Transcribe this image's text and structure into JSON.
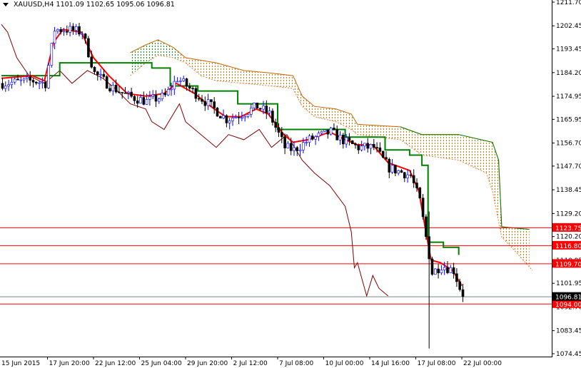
{
  "header": {
    "symbol": "XAUUSD,H4",
    "open": "1101.09",
    "high": "1102.65",
    "low": "1095.06",
    "close": "1096.81"
  },
  "colors": {
    "bull": "#0000ff",
    "bear": "#000000",
    "tenkan": "#ff0000",
    "kijun": "#008000",
    "chikou": "#800000",
    "cloud_bear": "#ff6600",
    "cloud_bull": "#00a000",
    "level": "#ff0000",
    "bid": "#778899"
  },
  "chart_data": {
    "type": "candlestick",
    "price_axis": {
      "range": [
        1074.45,
        1211.7
      ],
      "ticks": [
        "1211.70",
        "1202.45",
        "1193.45",
        "1184.20",
        "1174.95",
        "1165.95",
        "1156.70",
        "1147.70",
        "1138.45",
        "1129.20",
        "1120.20",
        "1110.95",
        "1101.95",
        "1092.70",
        "1083.45",
        "1074.45"
      ]
    },
    "time_axis": {
      "labels": [
        "15 Jun 2015",
        "17 Jun 20:00",
        "22 Jun 12:00",
        "25 Jun 04:00",
        "29 Jun 20:00",
        "2 Jul 12:00",
        "7 Jul 08:00",
        "10 Jul 00:00",
        "14 Jul 16:00",
        "17 Jul 08:00",
        "22 Jul 00:00"
      ],
      "bars_per_label": 15
    },
    "bars_visible": 180,
    "close_path": [
      [
        0,
        1180
      ],
      [
        10,
        1181
      ],
      [
        14,
        1180
      ],
      [
        17,
        1201
      ],
      [
        21,
        1201
      ],
      [
        26,
        1200
      ],
      [
        30,
        1184
      ],
      [
        35,
        1179
      ],
      [
        41,
        1175
      ],
      [
        47,
        1173
      ],
      [
        53,
        1175
      ],
      [
        57,
        1182
      ],
      [
        63,
        1176
      ],
      [
        67,
        1172
      ],
      [
        73,
        1166
      ],
      [
        78,
        1168
      ],
      [
        83,
        1171
      ],
      [
        87,
        1168
      ],
      [
        92,
        1155
      ],
      [
        95,
        1154
      ],
      [
        100,
        1158
      ],
      [
        107,
        1161
      ],
      [
        112,
        1157
      ],
      [
        116,
        1155
      ],
      [
        121,
        1155
      ],
      [
        126,
        1147
      ],
      [
        133,
        1144
      ],
      [
        136,
        1134
      ],
      [
        138,
        1120
      ],
      [
        140,
        1106
      ],
      [
        143,
        1109
      ],
      [
        147,
        1107
      ],
      [
        150,
        1096.81
      ]
    ],
    "spike": {
      "bar": 139,
      "low": 1076.5,
      "high": 1130
    },
    "tenkan": [
      [
        0,
        1182
      ],
      [
        10,
        1183
      ],
      [
        14,
        1181
      ],
      [
        17,
        1196
      ],
      [
        20,
        1201
      ],
      [
        26,
        1200
      ],
      [
        30,
        1190
      ],
      [
        35,
        1183
      ],
      [
        41,
        1176
      ],
      [
        47,
        1175
      ],
      [
        53,
        1176
      ],
      [
        57,
        1180
      ],
      [
        63,
        1176
      ],
      [
        67,
        1172
      ],
      [
        73,
        1167
      ],
      [
        78,
        1167
      ],
      [
        83,
        1170
      ],
      [
        87,
        1168
      ],
      [
        92,
        1160
      ],
      [
        95,
        1157
      ],
      [
        100,
        1158
      ],
      [
        107,
        1161
      ],
      [
        112,
        1158
      ],
      [
        116,
        1156
      ],
      [
        121,
        1156
      ],
      [
        126,
        1149
      ],
      [
        133,
        1146
      ],
      [
        136,
        1138
      ],
      [
        138,
        1124
      ],
      [
        140,
        1111
      ],
      [
        143,
        1110
      ],
      [
        147,
        1107
      ],
      [
        150,
        1101
      ]
    ],
    "kijun": [
      [
        0,
        1183
      ],
      [
        17,
        1183
      ],
      [
        19,
        1188
      ],
      [
        42,
        1188
      ],
      [
        49,
        1186
      ],
      [
        55,
        1179
      ],
      [
        64,
        1177
      ],
      [
        75,
        1177
      ],
      [
        77,
        1172
      ],
      [
        89,
        1172
      ],
      [
        90,
        1162
      ],
      [
        109,
        1162
      ],
      [
        112,
        1159
      ],
      [
        125,
        1154
      ],
      [
        133,
        1152
      ],
      [
        137,
        1148
      ],
      [
        139,
        1118
      ],
      [
        144,
        1116
      ],
      [
        149,
        1113
      ]
    ],
    "chikou": [
      [
        0,
        1203
      ],
      [
        2,
        1200
      ],
      [
        5,
        1190
      ],
      [
        9,
        1183
      ],
      [
        14,
        1180
      ],
      [
        19,
        1185
      ],
      [
        23,
        1180
      ],
      [
        28,
        1185
      ],
      [
        33,
        1182
      ],
      [
        37,
        1178
      ],
      [
        42,
        1172
      ],
      [
        47,
        1170
      ],
      [
        49,
        1165
      ],
      [
        53,
        1162
      ],
      [
        58,
        1172
      ],
      [
        60,
        1165
      ],
      [
        65,
        1160
      ],
      [
        70,
        1155
      ],
      [
        74,
        1160
      ],
      [
        79,
        1158
      ],
      [
        84,
        1162
      ],
      [
        88,
        1155
      ],
      [
        93,
        1160
      ],
      [
        98,
        1150
      ],
      [
        102,
        1145
      ],
      [
        107,
        1140
      ],
      [
        112,
        1132
      ],
      [
        114,
        1122
      ],
      [
        115,
        1108
      ],
      [
        116,
        1110
      ],
      [
        119,
        1097
      ],
      [
        121,
        1105
      ],
      [
        123,
        1100
      ],
      [
        126,
        1097
      ]
    ],
    "span_top": [
      [
        42,
        1192
      ],
      [
        47,
        1195
      ],
      [
        51,
        1197
      ],
      [
        56,
        1194
      ],
      [
        60,
        1190
      ],
      [
        70,
        1188
      ],
      [
        79,
        1185
      ],
      [
        88,
        1184
      ],
      [
        95,
        1183
      ],
      [
        98,
        1175
      ],
      [
        102,
        1171
      ],
      [
        109,
        1170
      ],
      [
        114,
        1168
      ],
      [
        116,
        1164
      ],
      [
        130,
        1163
      ],
      [
        137,
        1160
      ],
      [
        149,
        1160
      ],
      [
        160,
        1157
      ],
      [
        162,
        1150
      ],
      [
        163,
        1124
      ],
      [
        172,
        1123
      ]
    ],
    "span_bottom": [
      [
        42,
        1183
      ],
      [
        47,
        1188
      ],
      [
        51,
        1191
      ],
      [
        56,
        1190
      ],
      [
        60,
        1188
      ],
      [
        65,
        1183
      ],
      [
        70,
        1181
      ],
      [
        79,
        1180
      ],
      [
        88,
        1179
      ],
      [
        95,
        1178
      ],
      [
        98,
        1171
      ],
      [
        102,
        1167
      ],
      [
        109,
        1165
      ],
      [
        114,
        1162
      ],
      [
        116,
        1160
      ],
      [
        130,
        1158
      ],
      [
        137,
        1152
      ],
      [
        149,
        1150
      ],
      [
        158,
        1145
      ],
      [
        160,
        1138
      ],
      [
        163,
        1120
      ],
      [
        167,
        1115
      ],
      [
        173,
        1107
      ]
    ],
    "levels": [
      {
        "price": 1123.75,
        "label": "1123.75"
      },
      {
        "price": 1116.8,
        "label": "1116.80"
      },
      {
        "price": 1109.7,
        "label": "1109.70"
      },
      {
        "price": 1094.0,
        "label": "1094.00"
      }
    ],
    "bid": {
      "price": 1096.81,
      "label": "1096.81"
    }
  }
}
